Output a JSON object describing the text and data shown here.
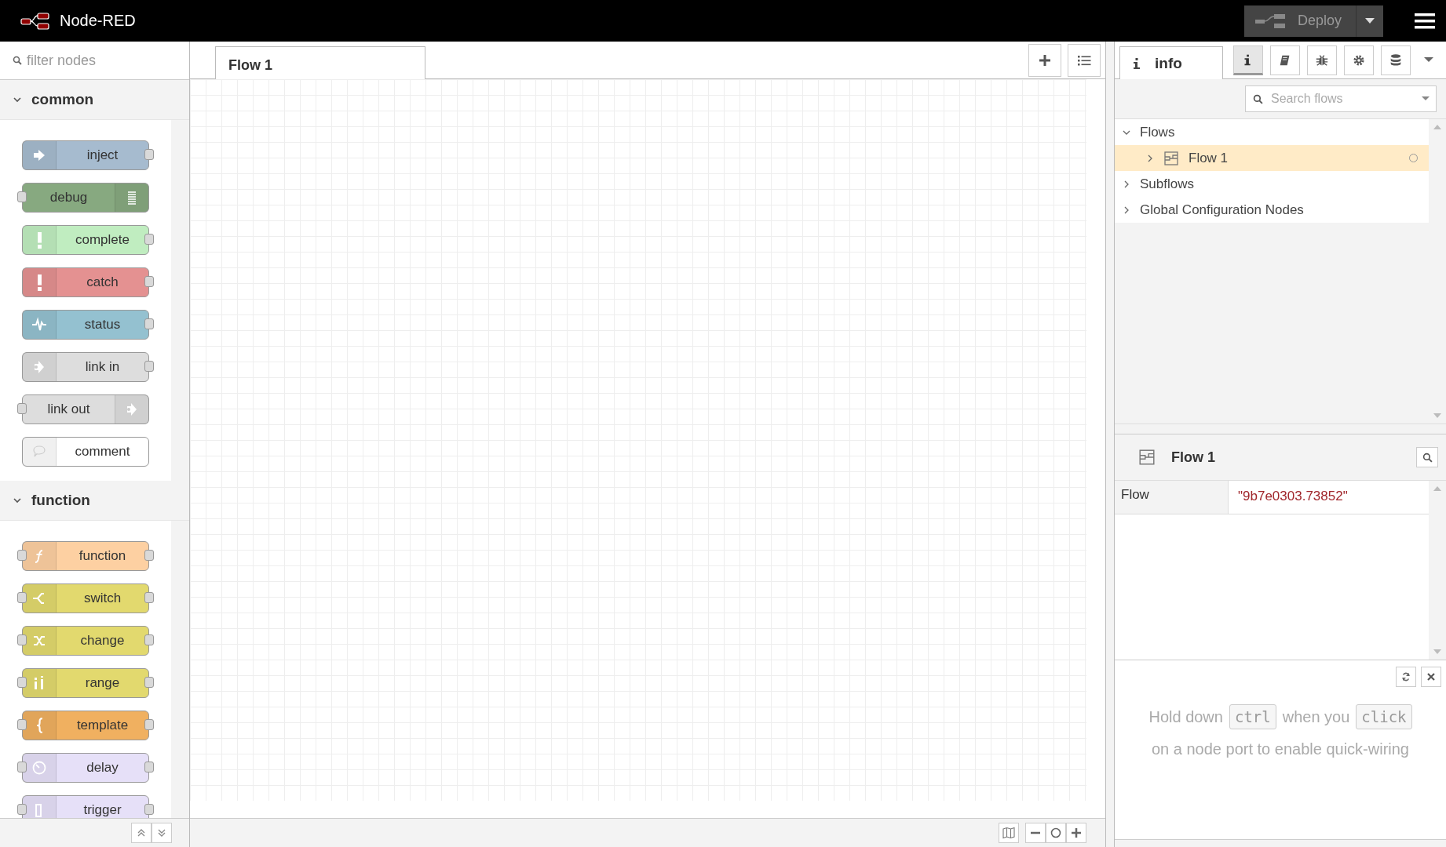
{
  "header": {
    "title": "Node-RED",
    "deploy": "Deploy"
  },
  "palette": {
    "filter_placeholder": "filter nodes",
    "categories": [
      {
        "name": "common",
        "expanded": true,
        "nodes": [
          {
            "label": "inject",
            "color": "#a6bbcf",
            "input": false,
            "output": true,
            "icon_right": false
          },
          {
            "label": "debug",
            "color": "#87a980",
            "input": true,
            "output": false,
            "icon_right": true
          },
          {
            "label": "complete",
            "color": "#c0edc0",
            "input": false,
            "output": true,
            "icon_right": false
          },
          {
            "label": "catch",
            "color": "#e49191",
            "input": false,
            "output": true,
            "icon_right": false
          },
          {
            "label": "status",
            "color": "#94c1d0",
            "input": false,
            "output": true,
            "icon_right": false
          },
          {
            "label": "link in",
            "color": "#dddddd",
            "input": false,
            "output": true,
            "icon_right": false
          },
          {
            "label": "link out",
            "color": "#dddddd",
            "input": true,
            "output": false,
            "icon_right": true
          },
          {
            "label": "comment",
            "color": "#ffffff",
            "input": false,
            "output": false,
            "icon_right": false
          }
        ]
      },
      {
        "name": "function",
        "expanded": true,
        "nodes": [
          {
            "label": "function",
            "color": "#fdd0a2",
            "input": true,
            "output": true,
            "icon_right": false
          },
          {
            "label": "switch",
            "color": "#e2d96e",
            "input": true,
            "output": true,
            "icon_right": false
          },
          {
            "label": "change",
            "color": "#e2d96e",
            "input": true,
            "output": true,
            "icon_right": false
          },
          {
            "label": "range",
            "color": "#e2d96e",
            "input": true,
            "output": true,
            "icon_right": false
          },
          {
            "label": "template",
            "color": "#f0b060",
            "input": true,
            "output": true,
            "icon_right": false
          },
          {
            "label": "delay",
            "color": "#e6e0f8",
            "input": true,
            "output": true,
            "icon_right": false
          },
          {
            "label": "trigger",
            "color": "#e6e0f8",
            "input": true,
            "output": true,
            "icon_right": false
          }
        ]
      }
    ]
  },
  "workspace": {
    "tabs": [
      {
        "label": "Flow 1",
        "selected": true
      }
    ]
  },
  "sidebar": {
    "tabs": [
      {
        "label": "info",
        "selected": true
      }
    ],
    "tab_buttons": [
      {
        "selected": true
      },
      {
        "selected": false
      },
      {
        "selected": false
      },
      {
        "selected": false
      },
      {
        "selected": false
      }
    ],
    "search_placeholder": "Search flows",
    "tree": [
      {
        "label": "Flows",
        "expanded": true,
        "selected": false,
        "children": [
          {
            "label": "Flow 1",
            "expanded": false,
            "selected": true
          }
        ]
      },
      {
        "label": "Subflows",
        "expanded": false,
        "selected": false
      },
      {
        "label": "Global Configuration Nodes",
        "expanded": false,
        "selected": false
      }
    ],
    "info": {
      "title": "Flow 1",
      "properties": [
        {
          "name": "Flow",
          "value": "\"9b7e0303.73852\""
        }
      ]
    },
    "tip": [
      {
        "kind": "text",
        "text": "Hold down"
      },
      {
        "kind": "key",
        "text": "ctrl"
      },
      {
        "kind": "text",
        "text": "when you"
      },
      {
        "kind": "key",
        "text": "click"
      },
      {
        "kind": "text",
        "text": "on a node port to enable quick-wiring"
      }
    ]
  }
}
